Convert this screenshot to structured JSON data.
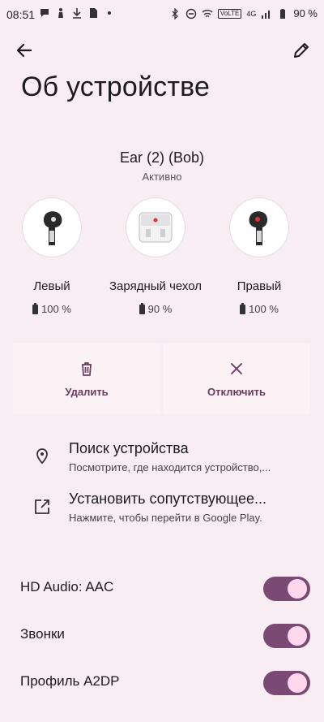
{
  "status_bar": {
    "time": "08:51",
    "network_label": "VoLTE",
    "network_gen": "4G",
    "battery": "90 %"
  },
  "header": {
    "title": "Об устройстве"
  },
  "device": {
    "name": "Ear (2) (Bob)",
    "status": "Активно"
  },
  "components": [
    {
      "label": "Левый",
      "battery": "100 %"
    },
    {
      "label": "Зарядный чехол",
      "battery": "90 %"
    },
    {
      "label": "Правый",
      "battery": "100 %"
    }
  ],
  "actions": {
    "delete_label": "Удалить",
    "disconnect_label": "Отключить"
  },
  "rows": {
    "find": {
      "title": "Поиск устройства",
      "subtitle": "Посмотрите, где находится устройство,..."
    },
    "install": {
      "title": "Установить сопутствующее...",
      "subtitle": "Нажмите, чтобы перейти в Google Play."
    }
  },
  "toggles": [
    {
      "label": "HD Audio: AAC",
      "on": true
    },
    {
      "label": "Звонки",
      "on": true
    },
    {
      "label": "Профиль A2DP",
      "on": true
    }
  ],
  "colors": {
    "background": "#f8edf2",
    "accent": "#7b4a74",
    "knob": "#ffd8ee"
  }
}
